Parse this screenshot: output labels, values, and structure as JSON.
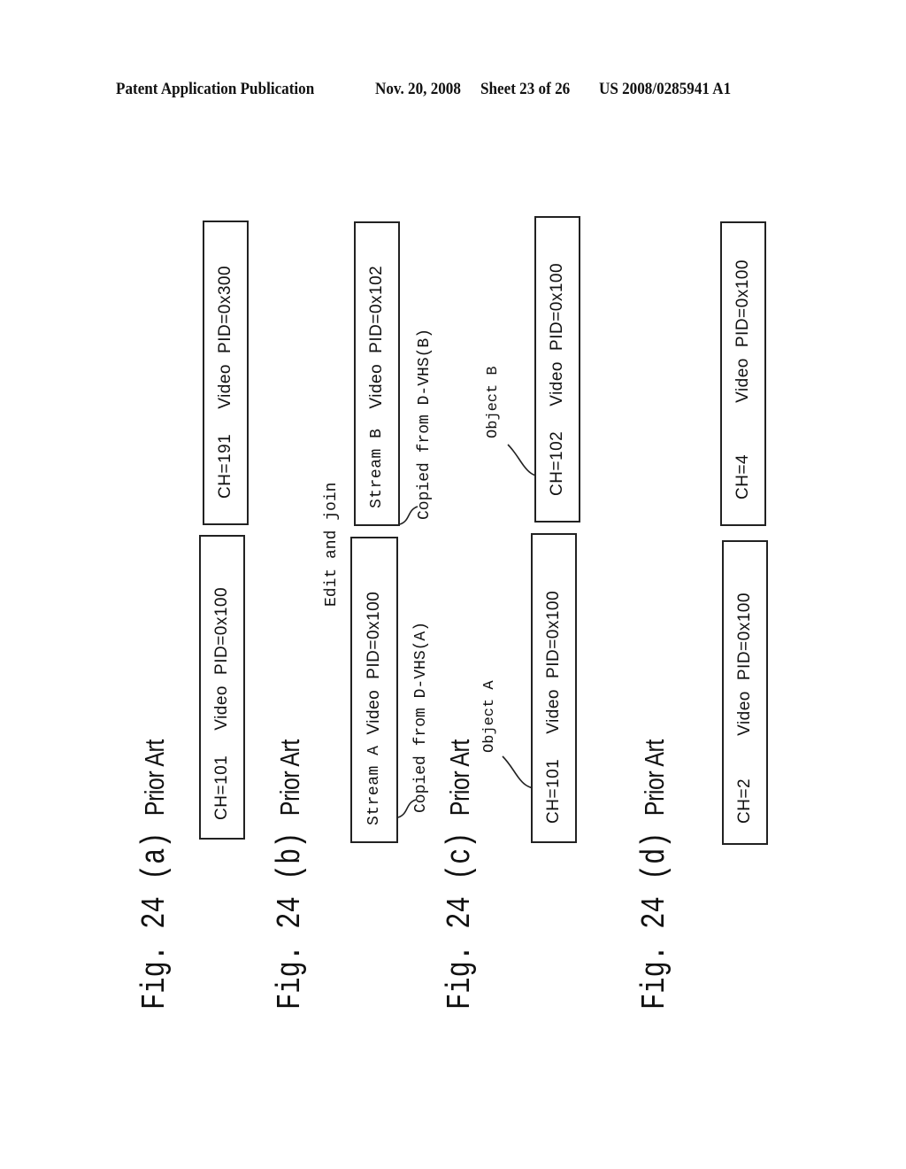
{
  "header": {
    "publication": "Patent Application Publication",
    "date": "Nov. 20, 2008",
    "sheet": "Sheet 23 of 26",
    "number": "US 2008/0285941 A1"
  },
  "figures": [
    {
      "label": "Fig. 24 (a)",
      "subtitle": "Prior Art",
      "boxes": [
        {
          "ch": "CH=101",
          "type": "Video",
          "pid": "PID=0x100"
        },
        {
          "ch": "CH=191",
          "type": "Video",
          "pid": "PID=0x300"
        }
      ]
    },
    {
      "label": "Fig. 24 (b)",
      "subtitle": "Prior Art",
      "annotation": "Edit and join",
      "boxes": [
        {
          "ch": "Stream A",
          "type": "Video",
          "pid": "PID=0x100",
          "note": "Copied from D-VHS(A)"
        },
        {
          "ch": "Stream B",
          "type": "Video",
          "pid": "PID=0x102",
          "note": "Copied from D-VHS(B)"
        }
      ]
    },
    {
      "label": "Fig. 24 (c)",
      "subtitle": "Prior Art",
      "boxes": [
        {
          "ch": "CH=101",
          "type": "Video",
          "pid": "PID=0x100",
          "note": "Object A"
        },
        {
          "ch": "CH=102",
          "type": "Video",
          "pid": "PID=0x100",
          "note": "Object B"
        }
      ]
    },
    {
      "label": "Fig. 24 (d)",
      "subtitle": "Prior Art",
      "boxes": [
        {
          "ch": "CH=2",
          "type": "Video",
          "pid": "PID=0x100"
        },
        {
          "ch": "CH=4",
          "type": "Video",
          "pid": "PID=0x100"
        }
      ]
    }
  ]
}
